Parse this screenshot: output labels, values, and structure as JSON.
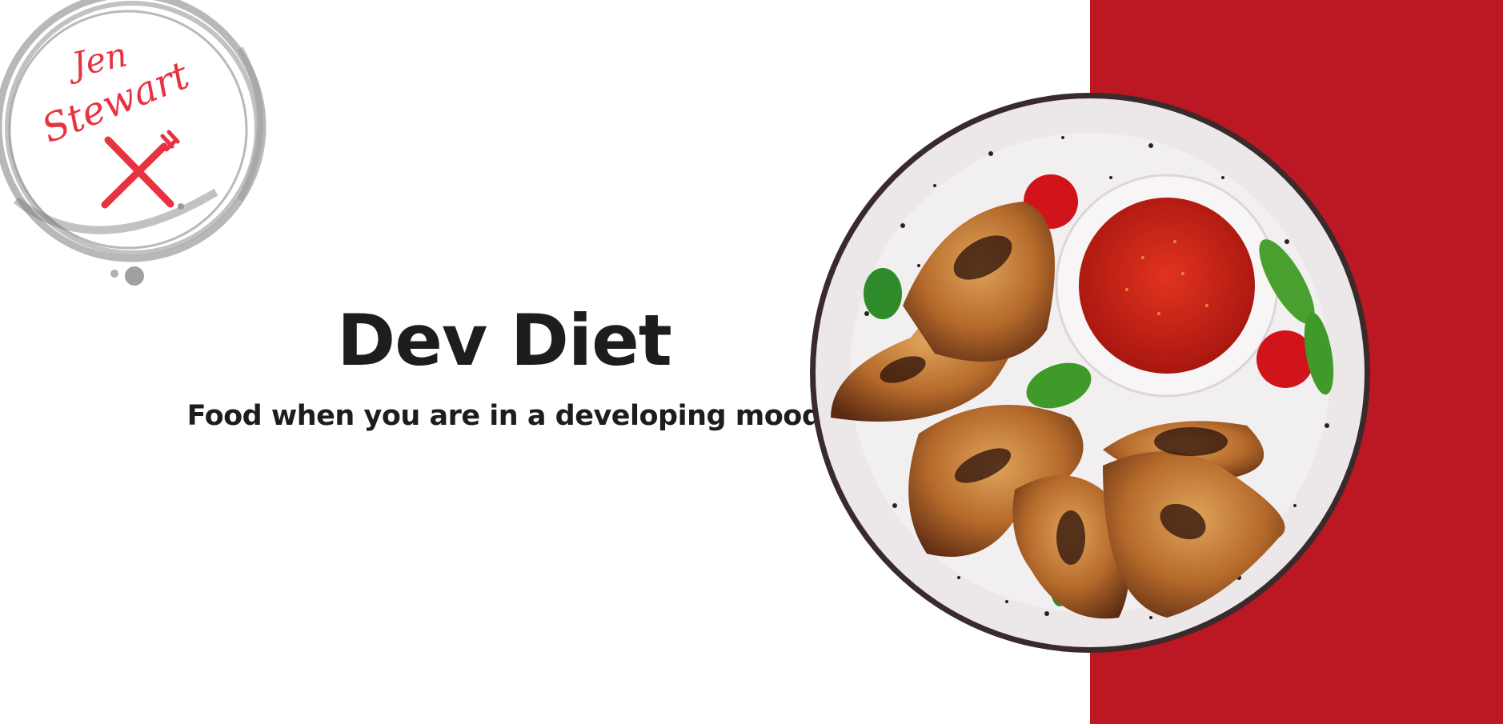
{
  "logo": {
    "line1": "Jen",
    "line2": "Stewart",
    "icon": "fork-knife-icon"
  },
  "hero": {
    "title": "Dev Diet",
    "subtitle": "Food when you are in a developing mood"
  },
  "image": {
    "subject": "plate-of-chicken-wings-with-dip"
  },
  "colors": {
    "accent": "#bb1823",
    "logo_text": "#e8323f",
    "text": "#1d1d1d",
    "background": "#ffffff"
  }
}
